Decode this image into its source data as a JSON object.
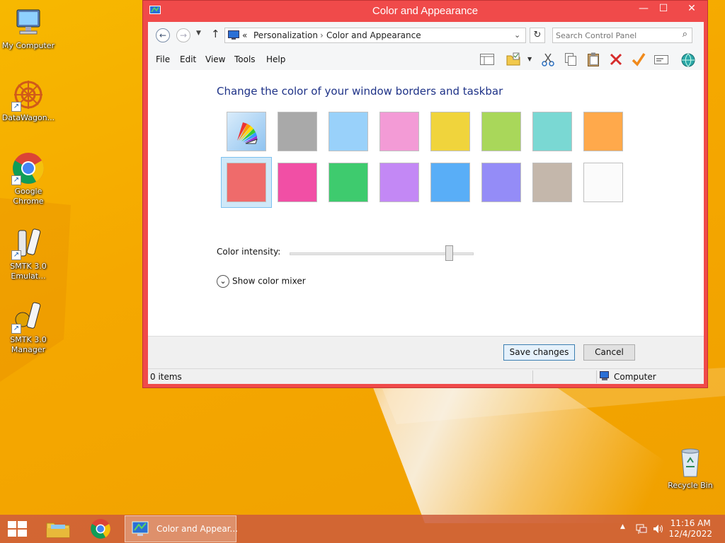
{
  "desktop": {
    "icons": [
      {
        "label": "My Computer"
      },
      {
        "label": "DataWagon..."
      },
      {
        "label": "Google Chrome"
      },
      {
        "label": "SMTK 3.0 Emulat..."
      },
      {
        "label": "SMTK 3.0 Manager"
      },
      {
        "label": "Recycle Bin"
      }
    ]
  },
  "window": {
    "title": "Color and Appearance",
    "controls": {
      "minimize": "—",
      "maximize": "☐",
      "close": "✕"
    },
    "address": {
      "prefix": "«",
      "crumbs": [
        "Personalization",
        "Color and Appearance"
      ],
      "sep": "›"
    },
    "search": {
      "placeholder": "Search Control Panel"
    },
    "menu": [
      "File",
      "Edit",
      "View",
      "Tools",
      "Help"
    ],
    "heading": "Change the color of your window borders and taskbar",
    "swatches_row1": [
      "auto",
      "#a9a9a9",
      "#99d1fa",
      "#f39bd6",
      "#f0d43c",
      "#a9d75a",
      "#7ad8d3",
      "#ffa94b"
    ],
    "swatches_row2": [
      "#ef6b6b",
      "#f14fa5",
      "#3ecb6e",
      "#c388f5",
      "#59aef7",
      "#948cf7",
      "#c4b7ab",
      "#fbfbfb"
    ],
    "selected_swatch": "row2-1",
    "intensity_label": "Color intensity:",
    "intensity_value": 0.86,
    "mixer_label": "Show color mixer",
    "save_label": "Save changes",
    "cancel_label": "Cancel",
    "status_items": "0 items",
    "status_location": "Computer"
  },
  "taskbar": {
    "active_app": "Color and Appear...",
    "time": "11:16 AM",
    "date": "12/4/2022"
  }
}
